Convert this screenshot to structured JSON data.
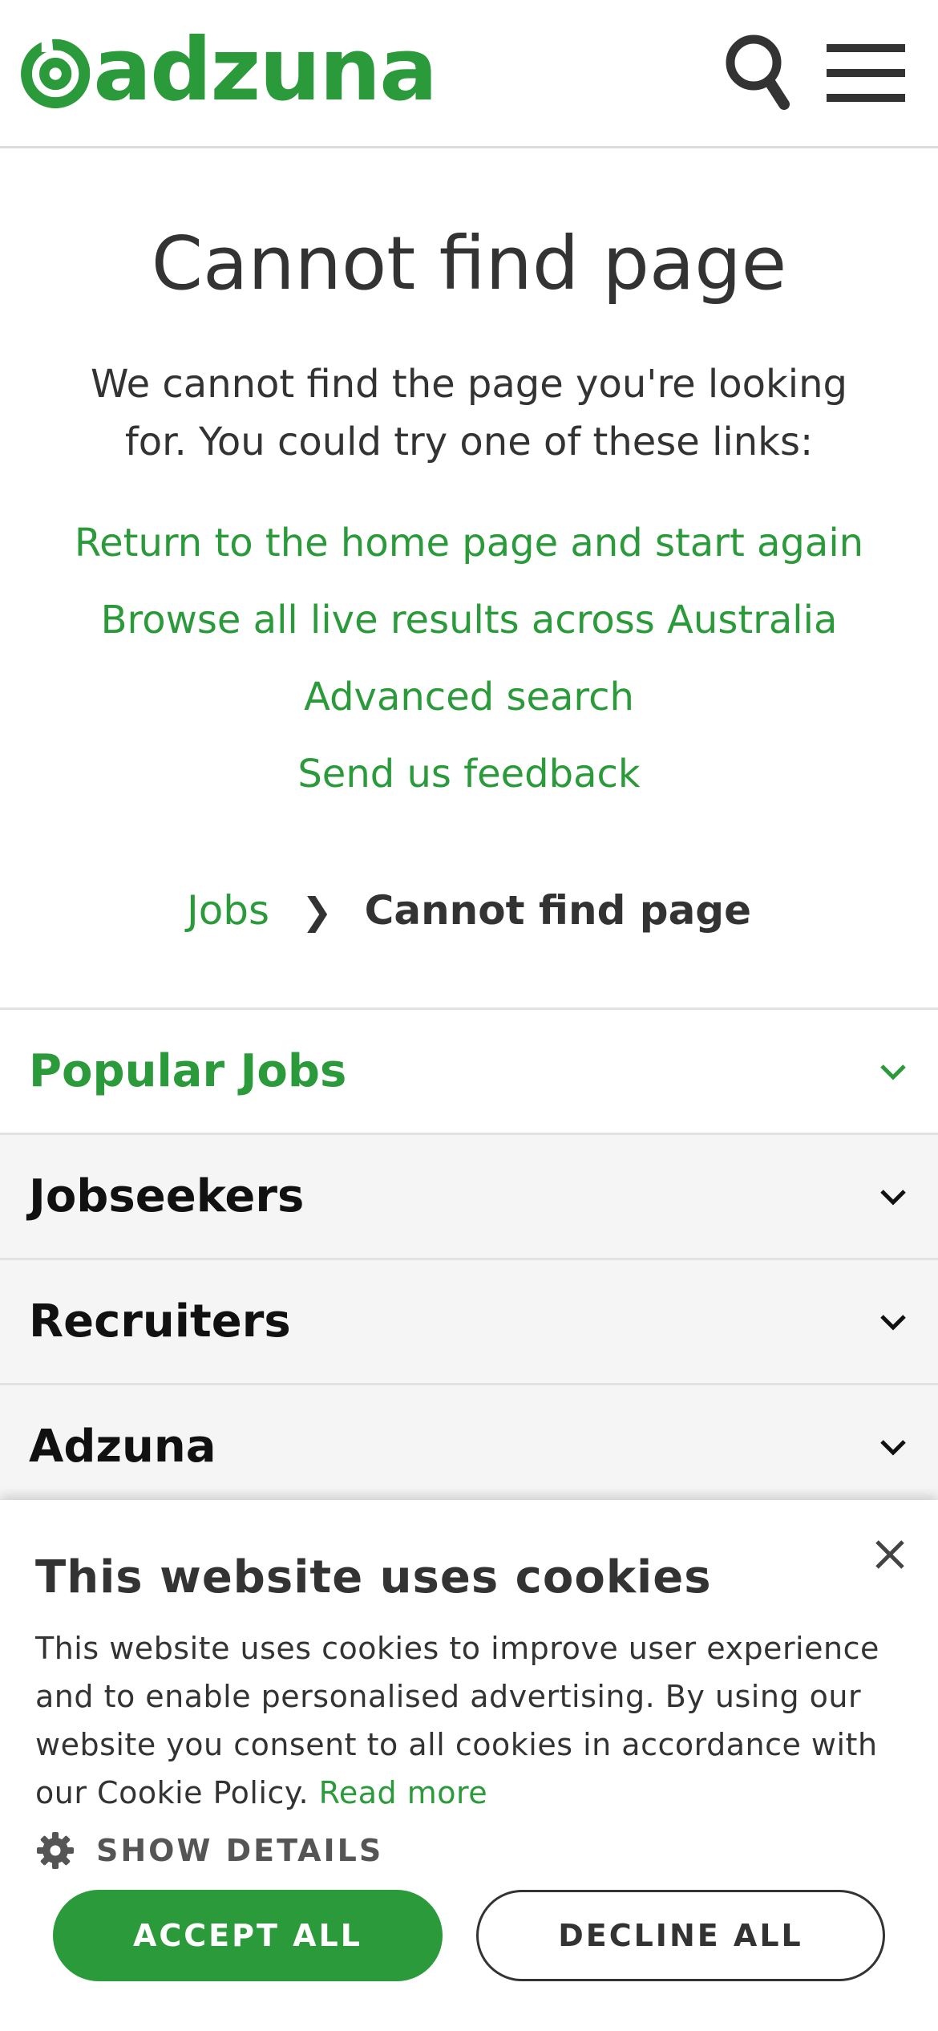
{
  "header": {
    "logo_text": "adzuna",
    "icons": {
      "logo": "adzuna-swirl-logo",
      "search": "search-icon",
      "menu": "hamburger-menu-icon"
    }
  },
  "main": {
    "title": "Cannot find page",
    "intro": "We cannot find the page you're looking for. You could try one of these links:",
    "links": [
      {
        "label": "Return to the home page and start again"
      },
      {
        "label": "Browse all live results across Australia"
      },
      {
        "label": "Advanced search"
      },
      {
        "label": "Send us feedback"
      }
    ]
  },
  "breadcrumb": {
    "parent": "Jobs",
    "separator": "❯",
    "current": "Cannot find page"
  },
  "accordion": {
    "items": [
      {
        "label": "Popular Jobs"
      },
      {
        "label": "Jobseekers"
      },
      {
        "label": "Recruiters"
      },
      {
        "label": "Adzuna"
      }
    ]
  },
  "cookie_banner": {
    "title": "This website uses cookies",
    "text": "This website uses cookies to improve user experience and to enable personalised advertising. By using our website you consent to all cookies in accordance with our Cookie Policy.",
    "read_more": "Read more",
    "show_details": "SHOW DETAILS",
    "accept_label": "ACCEPT ALL",
    "decline_label": "DECLINE ALL"
  },
  "colors": {
    "brand_green": "#2b9a3a",
    "text_dark": "#333333",
    "accordion_bg": "#f5f5f5"
  }
}
